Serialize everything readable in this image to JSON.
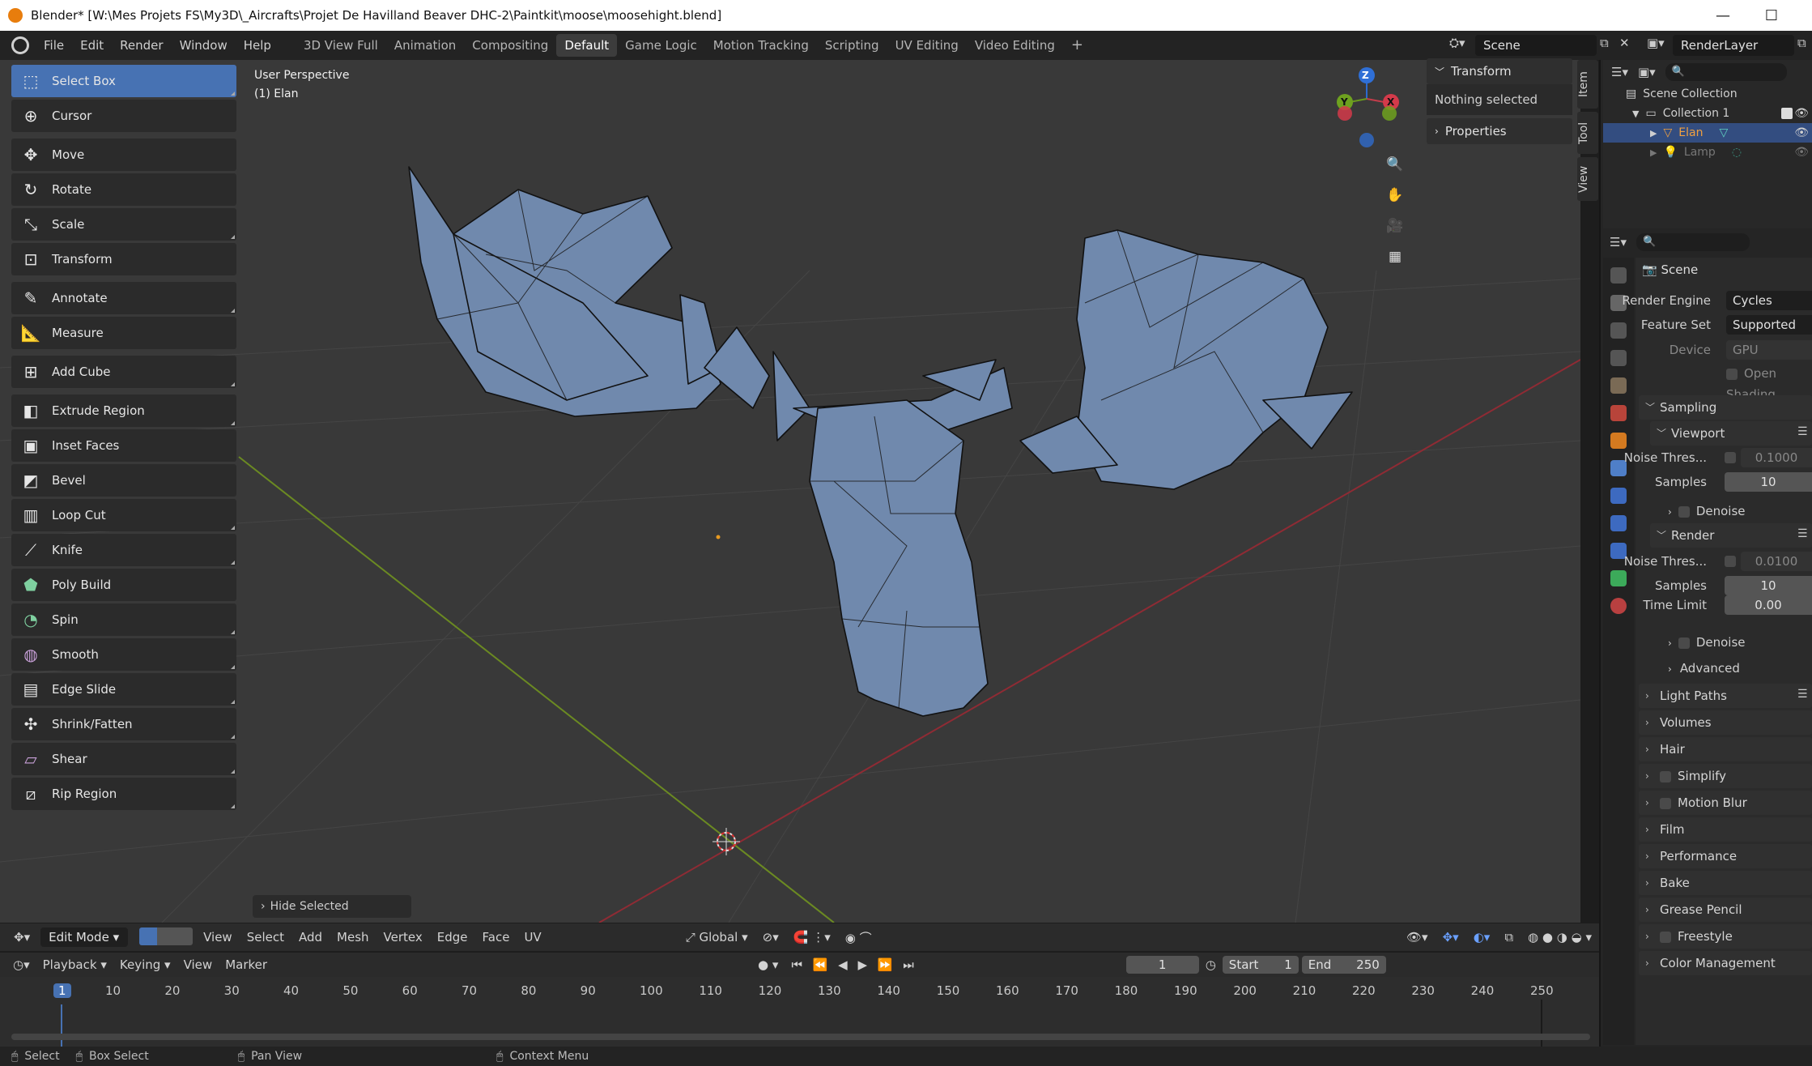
{
  "window": {
    "title": "Blender* [W:\\Mes Projets FS\\My3D\\_Aircrafts\\Projet De Havilland Beaver DHC-2\\Paintkit\\moose\\moosehight.blend]"
  },
  "menu": [
    "File",
    "Edit",
    "Render",
    "Window",
    "Help"
  ],
  "workspaces": [
    {
      "label": "3D View Full",
      "active": false
    },
    {
      "label": "Animation",
      "active": false
    },
    {
      "label": "Compositing",
      "active": false
    },
    {
      "label": "Default",
      "active": true
    },
    {
      "label": "Game Logic",
      "active": false
    },
    {
      "label": "Motion Tracking",
      "active": false
    },
    {
      "label": "Scripting",
      "active": false
    },
    {
      "label": "UV Editing",
      "active": false
    },
    {
      "label": "Video Editing",
      "active": false
    }
  ],
  "add_workspace": "+",
  "scene_field": "Scene",
  "layer_field": "RenderLayer",
  "viewport": {
    "perspective": "User Perspective",
    "object": "(1) Elan",
    "hide_selected": "Hide Selected"
  },
  "tools": [
    {
      "label": "Select Box",
      "icon": "select-box-icon",
      "selected": true
    },
    {
      "label": "Cursor",
      "icon": "cursor-icon"
    },
    {
      "label": "Move",
      "icon": "move-icon"
    },
    {
      "label": "Rotate",
      "icon": "rotate-icon"
    },
    {
      "label": "Scale",
      "icon": "scale-icon"
    },
    {
      "label": "Transform",
      "icon": "transform-icon"
    },
    {
      "label": "Annotate",
      "icon": "annotate-icon"
    },
    {
      "label": "Measure",
      "icon": "measure-icon"
    },
    {
      "label": "Add Cube",
      "icon": "add-cube-icon"
    },
    {
      "label": "Extrude Region",
      "icon": "extrude-icon"
    },
    {
      "label": "Inset Faces",
      "icon": "inset-icon"
    },
    {
      "label": "Bevel",
      "icon": "bevel-icon"
    },
    {
      "label": "Loop Cut",
      "icon": "loop-cut-icon"
    },
    {
      "label": "Knife",
      "icon": "knife-icon"
    },
    {
      "label": "Poly Build",
      "icon": "poly-build-icon"
    },
    {
      "label": "Spin",
      "icon": "spin-icon"
    },
    {
      "label": "Smooth",
      "icon": "smooth-icon"
    },
    {
      "label": "Edge Slide",
      "icon": "edge-slide-icon"
    },
    {
      "label": "Shrink/Fatten",
      "icon": "shrink-fatten-icon"
    },
    {
      "label": "Shear",
      "icon": "shear-icon"
    },
    {
      "label": "Rip Region",
      "icon": "rip-region-icon"
    }
  ],
  "npanel": {
    "transform": "Transform",
    "nothing_selected": "Nothing selected",
    "properties": "Properties",
    "tabs": [
      "Item",
      "Tool",
      "View"
    ]
  },
  "gizmo": {
    "z": "Z",
    "y": "Y",
    "x": "X"
  },
  "header3d": {
    "mode": "Edit Mode",
    "menus": [
      "View",
      "Select",
      "Add",
      "Mesh",
      "Vertex",
      "Edge",
      "Face",
      "UV"
    ],
    "orientation": "Global"
  },
  "timeline_header": {
    "menus": [
      "Playback",
      "Keying",
      "View",
      "Marker"
    ],
    "frame": "1",
    "start_label": "Start",
    "start": "1",
    "end_label": "End",
    "end": "250"
  },
  "timeline_ticks": [
    "1",
    "10",
    "20",
    "30",
    "40",
    "50",
    "60",
    "70",
    "80",
    "90",
    "100",
    "110",
    "120",
    "130",
    "140",
    "150",
    "160",
    "170",
    "180",
    "190",
    "200",
    "210",
    "220",
    "230",
    "240",
    "250"
  ],
  "outliner": {
    "rows": [
      {
        "label": "Scene Collection",
        "depth": 0
      },
      {
        "label": "Collection 1",
        "depth": 1
      },
      {
        "label": "Elan",
        "depth": 2,
        "selected": true
      },
      {
        "label": "Lamp",
        "depth": 2,
        "dim": true
      }
    ]
  },
  "properties": {
    "scene": "Scene",
    "render_engine_label": "Render Engine",
    "render_engine": "Cycles",
    "feature_set_label": "Feature Set",
    "feature_set": "Supported",
    "device_label": "Device",
    "device": "GPU Compute",
    "open_shading": "Open Shading",
    "sampling": "Sampling",
    "viewport": "Viewport",
    "noise_label": "Noise Thres...",
    "vp_noise": "0.1000",
    "samples_label": "Samples",
    "vp_samples": "10",
    "denoise": "Denoise",
    "render": "Render",
    "r_noise": "0.0100",
    "r_samples": "10",
    "time_limit_label": "Time Limit",
    "time_limit": "0.00",
    "advanced": "Advanced",
    "sections": [
      "Light Paths",
      "Volumes",
      "Hair",
      "Simplify",
      "Motion Blur",
      "Film",
      "Performance",
      "Bake",
      "Grease Pencil",
      "Freestyle",
      "Color Management"
    ]
  },
  "status": {
    "select": "Select",
    "box_select": "Box Select",
    "pan_view": "Pan View",
    "context_menu": "Context Menu"
  }
}
